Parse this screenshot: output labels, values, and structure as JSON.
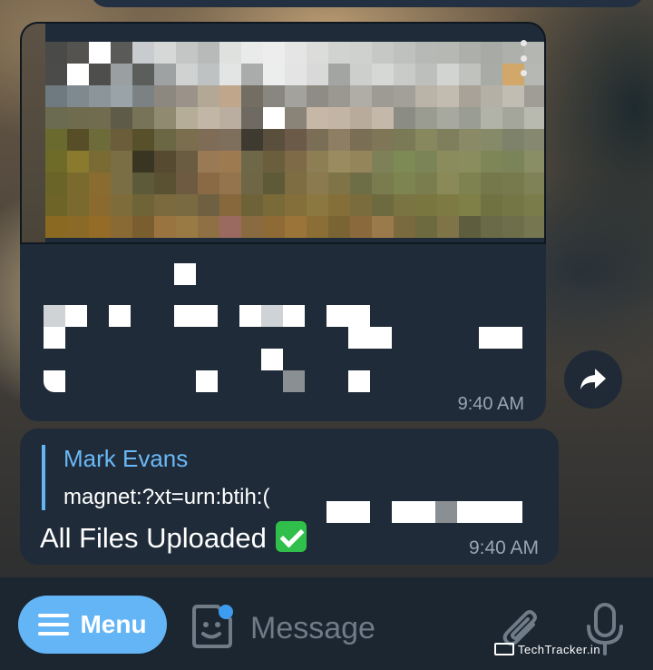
{
  "chat": {
    "message1": {
      "time": "9:40 AM"
    },
    "message2": {
      "reply_author": "Mark Evans",
      "reply_snippet": "magnet:?xt=urn:btih:(",
      "text": "All Files Uploaded",
      "time": "9:40 AM"
    }
  },
  "composer": {
    "menu_label": "Menu",
    "placeholder": "Message"
  },
  "watermark": "TechTracker.in",
  "colors": {
    "accent": "#64b5f6",
    "bubble": "#1f2b38",
    "bar": "#1b2631",
    "check": "#2fbf4a"
  },
  "icons": [
    "menu-icon",
    "sticker-icon",
    "attach-icon",
    "mic-icon",
    "forward-icon",
    "more-vertical-icon"
  ]
}
